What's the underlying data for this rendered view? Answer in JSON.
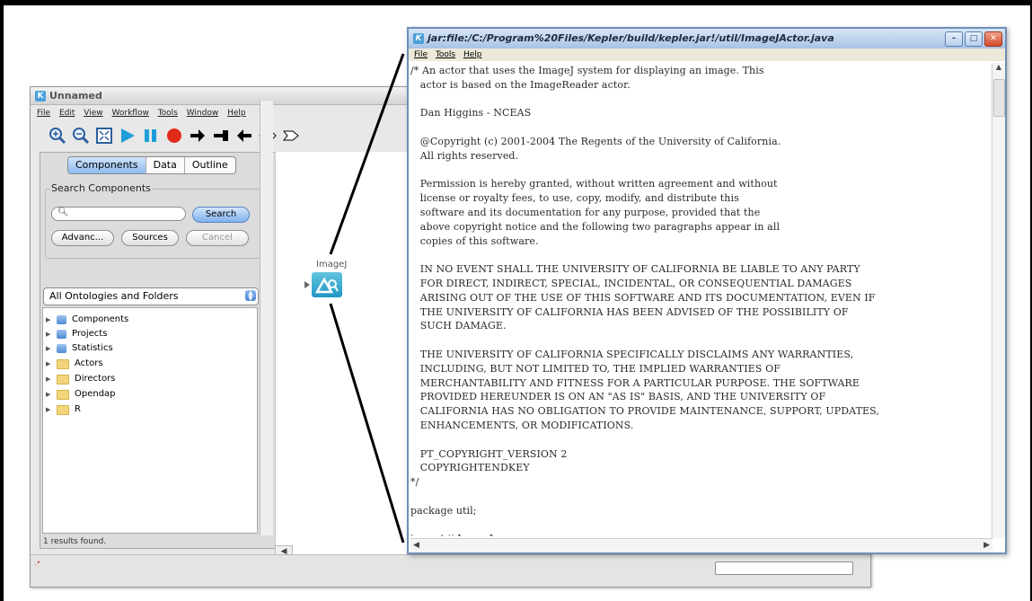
{
  "kepler": {
    "title": "Unnamed",
    "app_icon": "K",
    "menu": [
      "File",
      "Edit",
      "View",
      "Workflow",
      "Tools",
      "Window",
      "Help"
    ],
    "toolbar_icons": [
      "zoom-in-icon",
      "zoom-reset-icon",
      "zoom-fit-icon",
      "run-icon",
      "pause-icon",
      "stop-icon",
      "add-port-icon",
      "add-relation-icon",
      "add-input-port-icon",
      "add-output-port-icon",
      "add-io-port-icon"
    ],
    "tabs": [
      "Components",
      "Data",
      "Outline"
    ],
    "active_tab": "Components",
    "search": {
      "legend": "Search Components",
      "value": "",
      "search_label": "Search",
      "advanced_label": "Advanc...",
      "sources_label": "Sources",
      "cancel_label": "Cancel"
    },
    "ontology_select": "All Ontologies and Folders",
    "tree": [
      {
        "label": "Components",
        "icon": "database-icon"
      },
      {
        "label": "Projects",
        "icon": "database-icon"
      },
      {
        "label": "Statistics",
        "icon": "database-icon"
      },
      {
        "label": "Actors",
        "icon": "folder-icon"
      },
      {
        "label": "Directors",
        "icon": "folder-icon"
      },
      {
        "label": "Opendap",
        "icon": "folder-icon"
      },
      {
        "label": "R",
        "icon": "folder-icon"
      }
    ],
    "results_text": "1 results found.",
    "actor_label": "ImageJ",
    "colors": {
      "actor": "#2a9fcb",
      "stop": "#e02a1a",
      "play": "#1f9ed9"
    }
  },
  "source_window": {
    "title": "jar:file:/C:/Program%20Files/Kepler/build/kepler.jar!/util/ImageJActor.java",
    "app_icon": "K",
    "menu": [
      "File",
      "Tools",
      "Help"
    ],
    "code_lines": [
      "/* An actor that uses the ImageJ system for displaying an image. This",
      "   actor is based on the ImageReader actor.",
      "",
      "   Dan Higgins - NCEAS",
      "",
      "   @Copyright (c) 2001-2004 The Regents of the University of California.",
      "   All rights reserved.",
      "",
      "   Permission is hereby granted, without written agreement and without",
      "   license or royalty fees, to use, copy, modify, and distribute this",
      "   software and its documentation for any purpose, provided that the",
      "   above copyright notice and the following two paragraphs appear in all",
      "   copies of this software.",
      "",
      "   IN NO EVENT SHALL THE UNIVERSITY OF CALIFORNIA BE LIABLE TO ANY PARTY",
      "   FOR DIRECT, INDIRECT, SPECIAL, INCIDENTAL, OR CONSEQUENTIAL DAMAGES",
      "   ARISING OUT OF THE USE OF THIS SOFTWARE AND ITS DOCUMENTATION, EVEN IF",
      "   THE UNIVERSITY OF CALIFORNIA HAS BEEN ADVISED OF THE POSSIBILITY OF",
      "   SUCH DAMAGE.",
      "",
      "   THE UNIVERSITY OF CALIFORNIA SPECIFICALLY DISCLAIMS ANY WARRANTIES,",
      "   INCLUDING, BUT NOT LIMITED TO, THE IMPLIED WARRANTIES OF",
      "   MERCHANTABILITY AND FITNESS FOR A PARTICULAR PURPOSE. THE SOFTWARE",
      "   PROVIDED HEREUNDER IS ON AN \"AS IS\" BASIS, AND THE UNIVERSITY OF",
      "   CALIFORNIA HAS NO OBLIGATION TO PROVIDE MAINTENANCE, SUPPORT, UPDATES,",
      "   ENHANCEMENTS, OR MODIFICATIONS.",
      "",
      "   PT_COPYRIGHT_VERSION 2",
      "   COPYRIGHTENDKEY",
      "*/",
      "",
      "package util;",
      "",
      "import ij.ImageJ;"
    ]
  }
}
